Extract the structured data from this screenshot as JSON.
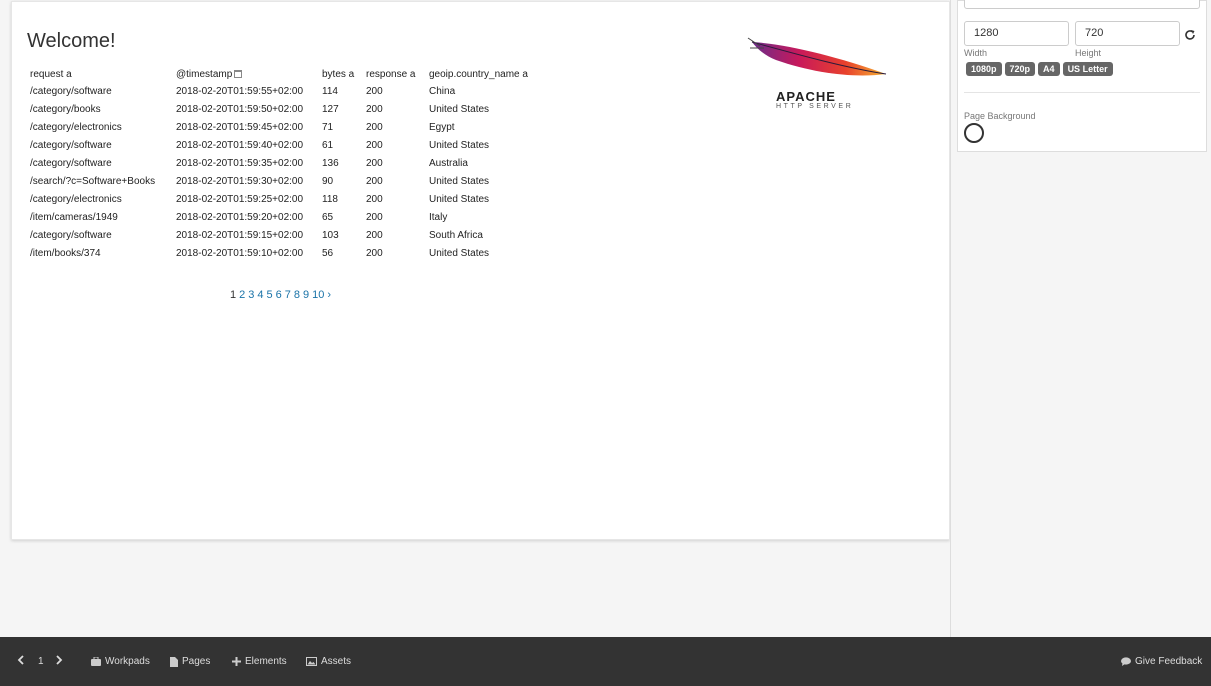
{
  "page": {
    "heading": "Welcome!",
    "table": {
      "headers": [
        "request a",
        "@timestamp",
        "bytes a",
        "response a",
        "geoip.country_name a"
      ],
      "rows": [
        [
          "/category/software",
          "2018-02-20T01:59:55+02:00",
          "114",
          "200",
          "China"
        ],
        [
          "/category/books",
          "2018-02-20T01:59:50+02:00",
          "127",
          "200",
          "United States"
        ],
        [
          "/category/electronics",
          "2018-02-20T01:59:45+02:00",
          "71",
          "200",
          "Egypt"
        ],
        [
          "/category/software",
          "2018-02-20T01:59:40+02:00",
          "61",
          "200",
          "United States"
        ],
        [
          "/category/software",
          "2018-02-20T01:59:35+02:00",
          "136",
          "200",
          "Australia"
        ],
        [
          "/search/?c=Software+Books",
          "2018-02-20T01:59:30+02:00",
          "90",
          "200",
          "United States"
        ],
        [
          "/category/electronics",
          "2018-02-20T01:59:25+02:00",
          "118",
          "200",
          "United States"
        ],
        [
          "/item/cameras/1949",
          "2018-02-20T01:59:20+02:00",
          "65",
          "200",
          "Italy"
        ],
        [
          "/category/software",
          "2018-02-20T01:59:15+02:00",
          "103",
          "200",
          "South Africa"
        ],
        [
          "/item/books/374",
          "2018-02-20T01:59:10+02:00",
          "56",
          "200",
          "United States"
        ]
      ]
    },
    "pagination": {
      "current": "1",
      "pages": [
        "2",
        "3",
        "4",
        "5",
        "6",
        "7",
        "8",
        "9",
        "10"
      ],
      "next": "›"
    },
    "logo": {
      "word": "APACHE",
      "sub": "HTTP SERVER"
    }
  },
  "sidebar": {
    "width_value": "1280",
    "height_value": "720",
    "width_label": "Width",
    "height_label": "Height",
    "presets": [
      "1080p",
      "720p",
      "A4",
      "US Letter"
    ],
    "background_label": "Page Background",
    "background_color": "#ffffff"
  },
  "footer": {
    "page_number": "1",
    "workpads": "Workpads",
    "pages": "Pages",
    "elements": "Elements",
    "assets": "Assets",
    "feedback": "Give Feedback"
  },
  "colors": {
    "link": "#1a73a8",
    "footer_bg": "#333333",
    "preset_bg": "#666666"
  }
}
